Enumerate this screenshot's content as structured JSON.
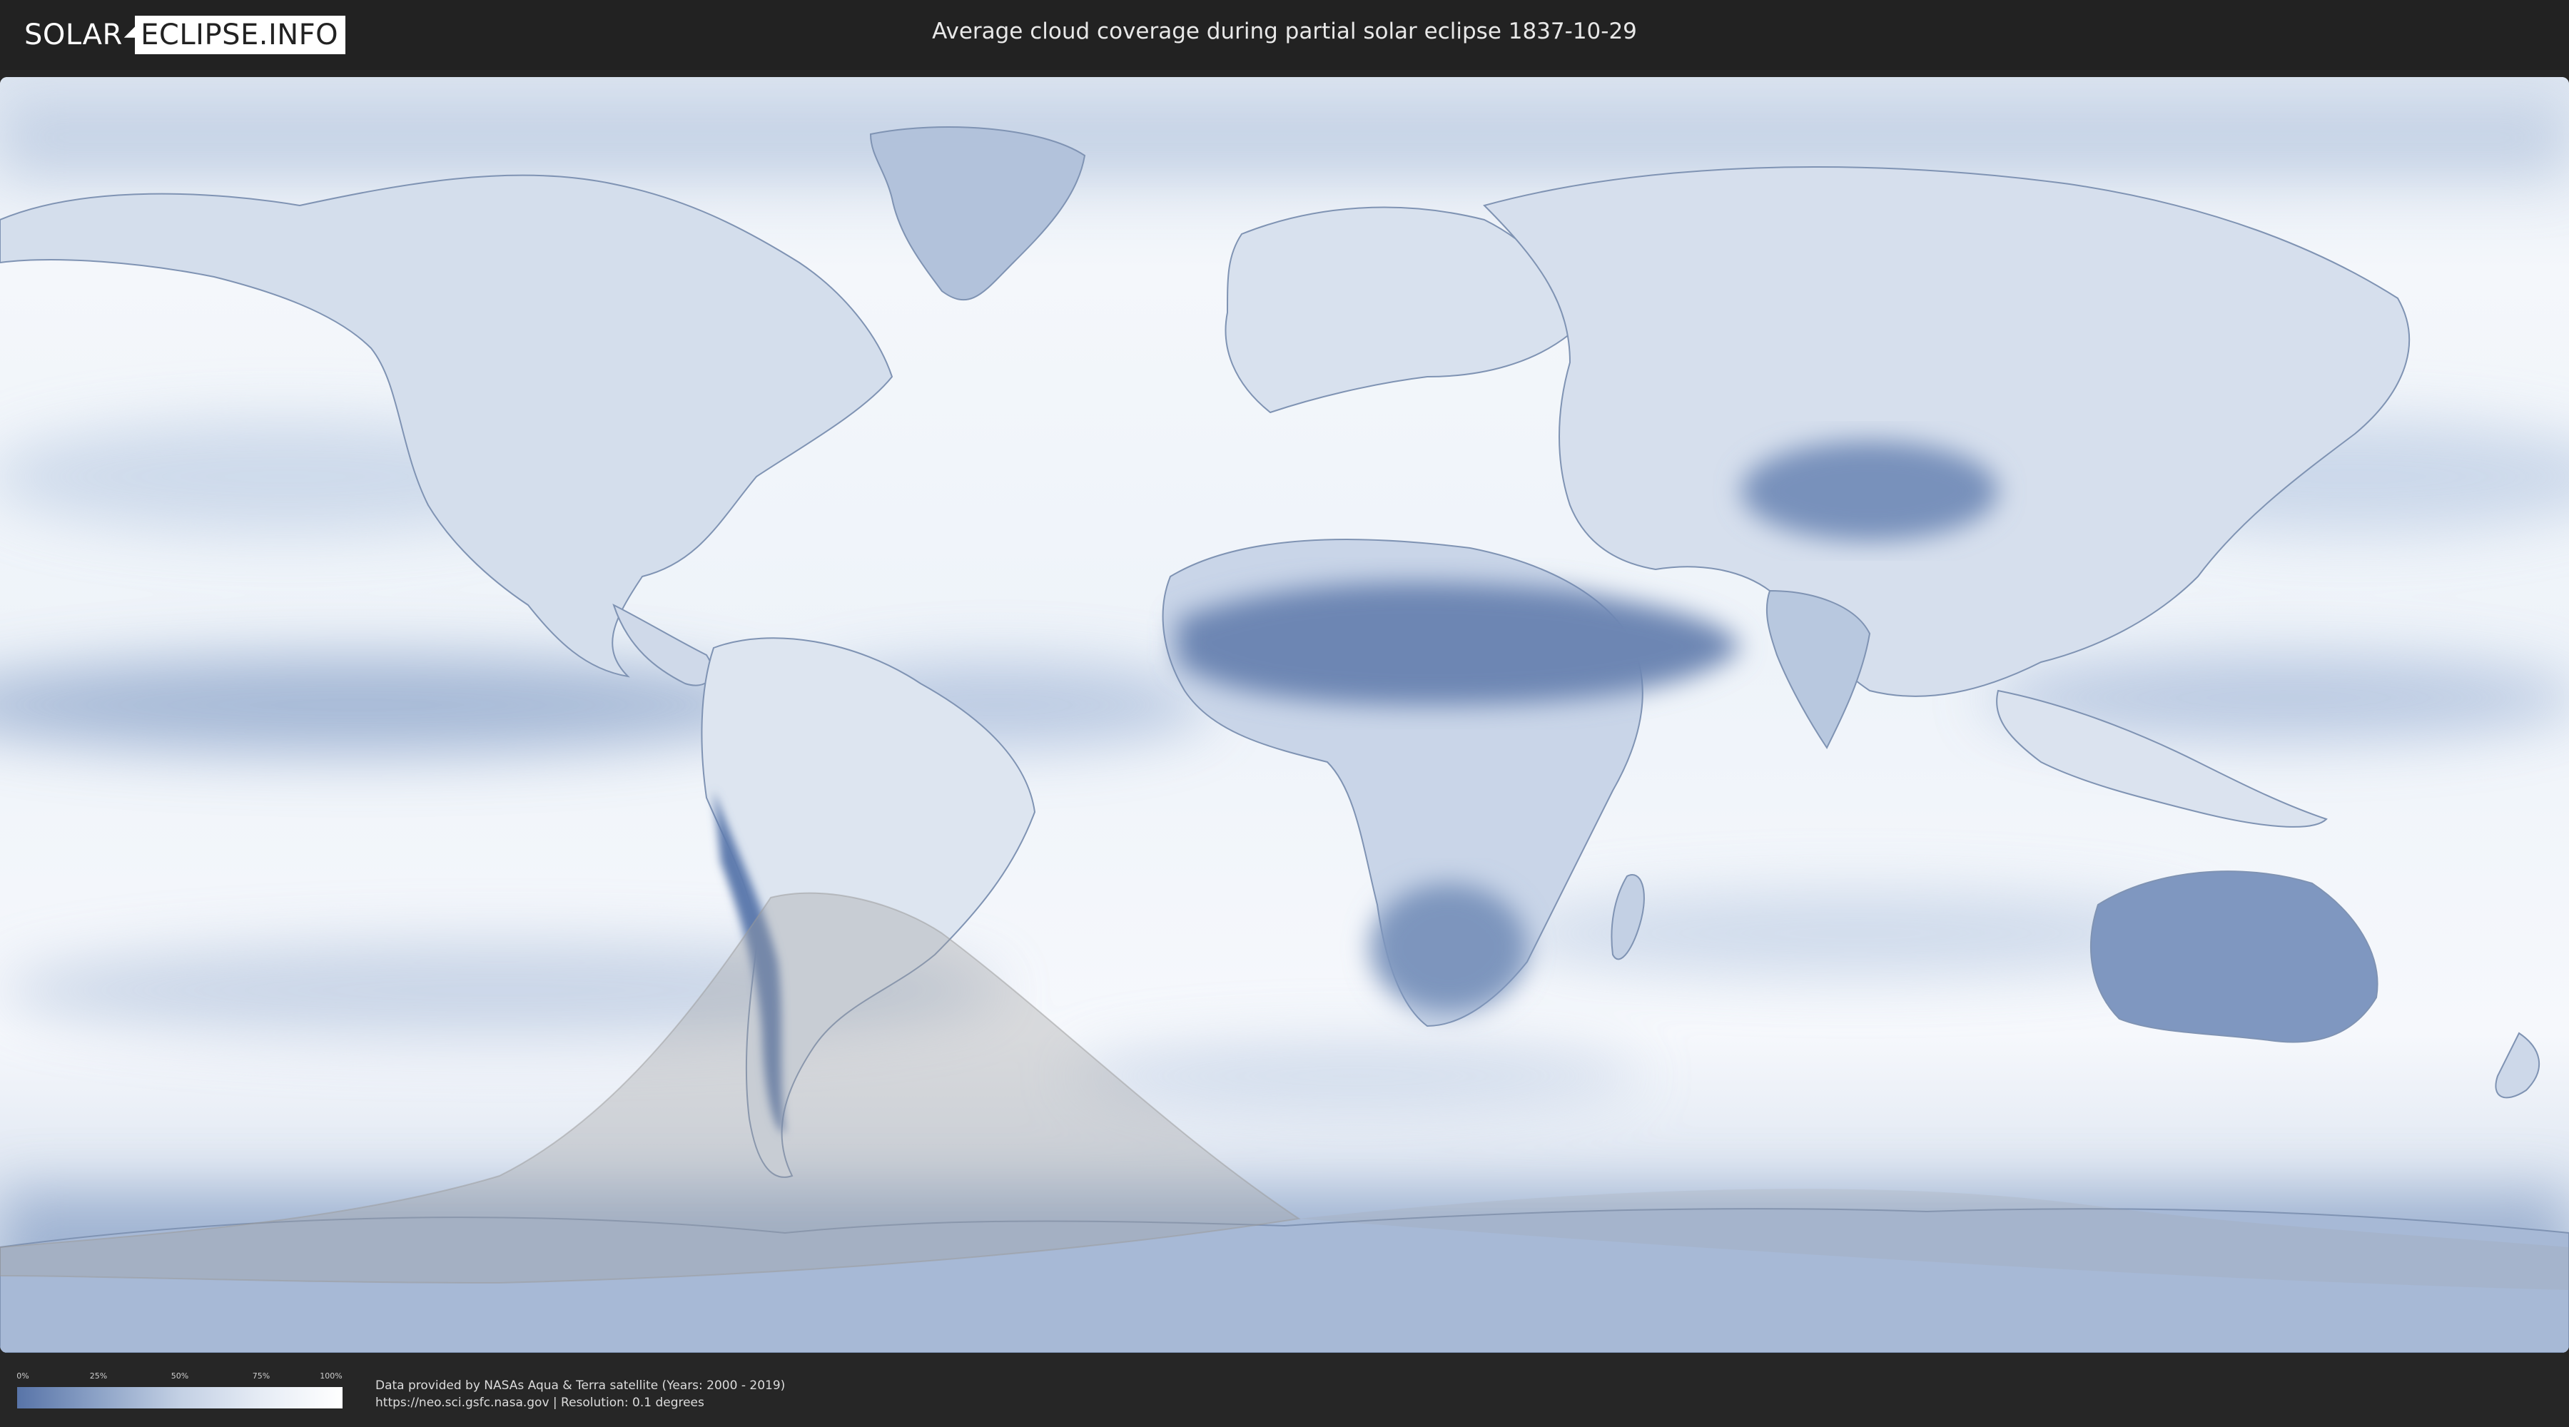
{
  "header": {
    "logo_part1": "SOLAR",
    "logo_part2": "ECLIPSE.INFO",
    "title": "Average cloud coverage during partial solar eclipse 1837-10-29"
  },
  "map": {
    "description_icon": "world-cloud-map",
    "colors": {
      "clear": "#ffffff",
      "cloudy": "#5874a8",
      "land_outline": "#7f93b3",
      "eclipse_shadow": "#a0a0a0"
    }
  },
  "legend": {
    "ticks": [
      "0%",
      "25%",
      "50%",
      "75%",
      "100%"
    ]
  },
  "footer": {
    "credit_line1": "Data provided by NASAs Aqua & Terra satellite (Years: 2000 - 2019)",
    "credit_line2": "https://neo.sci.gsfc.nasa.gov | Resolution: 0.1 degrees"
  }
}
